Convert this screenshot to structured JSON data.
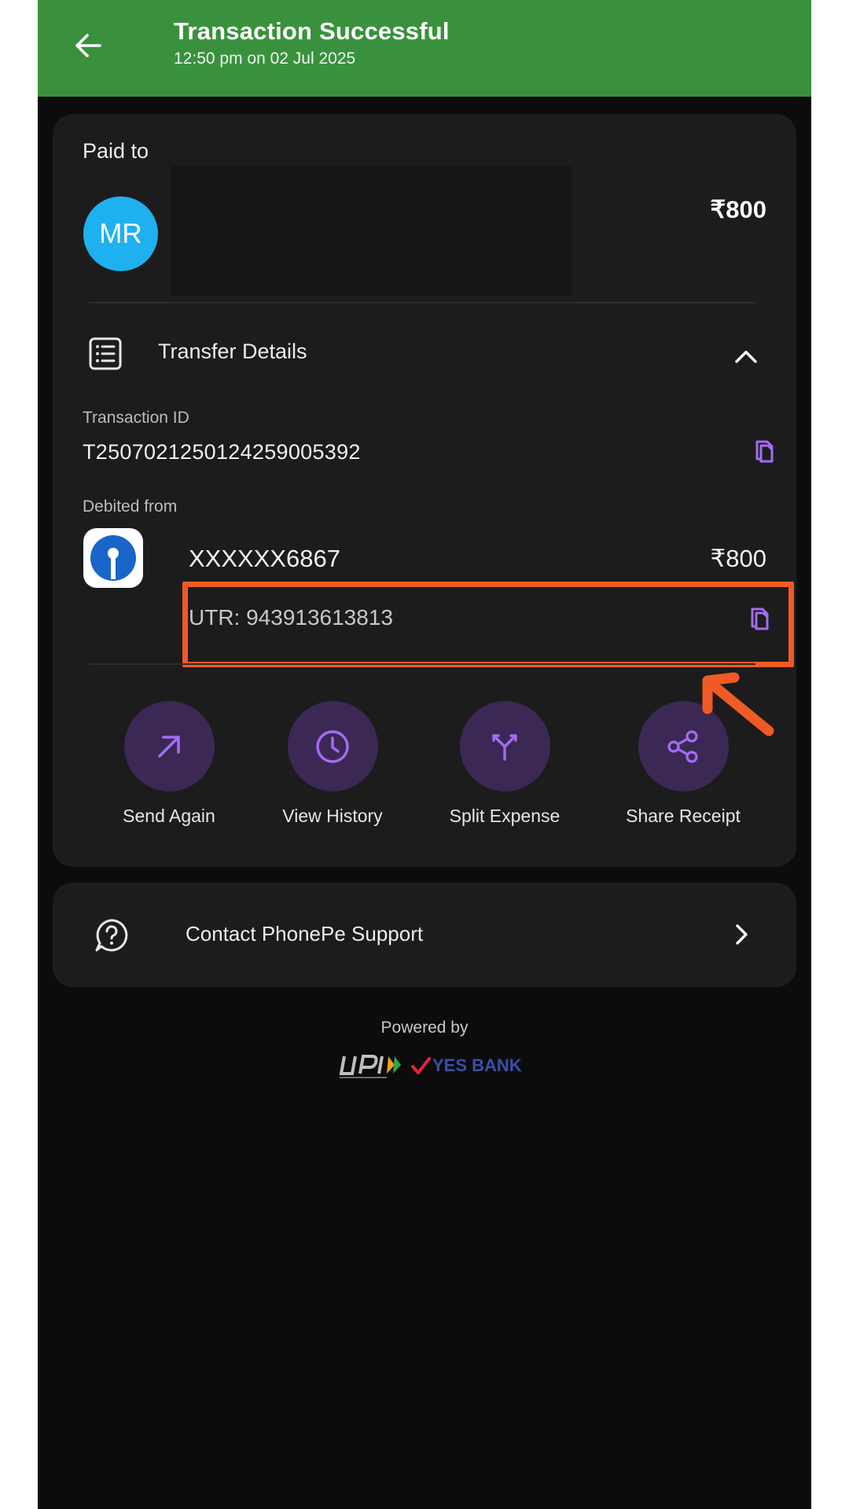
{
  "header": {
    "title": "Transaction Successful",
    "subtitle": "12:50 pm on 02 Jul 2025",
    "bg_color": "#3a913d"
  },
  "payee": {
    "section_label": "Paid to",
    "avatar_initials": "MR",
    "avatar_color": "#1fb0f0",
    "amount": "₹800"
  },
  "transfer_details": {
    "label": "Transfer Details",
    "transaction_id_label": "Transaction ID",
    "transaction_id": "T2507021250124259005392",
    "debited_from_label": "Debited from",
    "account": "XXXXXX6867",
    "account_amount": "₹800",
    "utr": "UTR: 943913613813"
  },
  "actions": [
    {
      "label": "Send Again",
      "icon": "arrow-up-right-icon"
    },
    {
      "label": "View History",
      "icon": "clock-icon"
    },
    {
      "label": "Split Expense",
      "icon": "split-icon"
    },
    {
      "label": "Share Receipt",
      "icon": "share-icon"
    }
  ],
  "support": {
    "label": "Contact PhonePe Support"
  },
  "footer": {
    "powered_by": "Powered by",
    "bank_name": "YES BANK"
  },
  "colors": {
    "accent_purple": "#a46cf0",
    "action_bg": "#3b2855",
    "annotation": "#f05a24"
  }
}
